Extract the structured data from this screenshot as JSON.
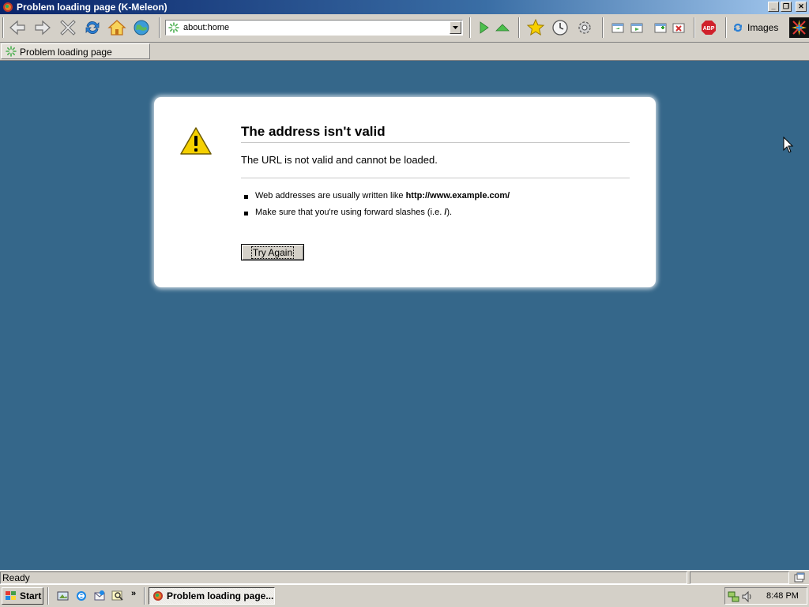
{
  "window": {
    "title": "Problem loading page (K-Meleon)",
    "controls": [
      "minimize",
      "restore",
      "close"
    ]
  },
  "toolbar": {
    "buttons": [
      "back-icon",
      "forward-icon",
      "stop-icon",
      "reload-icon",
      "home-icon",
      "globe-icon",
      "go-icon",
      "up-icon",
      "bookmarks-star-icon",
      "history-clock-icon",
      "settings-gear-icon",
      "window-prev-icon",
      "window-next-icon",
      "new-window-icon",
      "close-window-icon",
      "adblock-icon"
    ],
    "url": "about:home",
    "images_label": "Images"
  },
  "tabs": [
    {
      "label": "Problem loading page"
    }
  ],
  "error": {
    "title": "The address isn't valid",
    "message": "The URL is not valid and cannot be loaded.",
    "bullet1_prefix": "Web addresses are usually written like ",
    "bullet1_bold": "http://www.example.com/",
    "bullet2_prefix": "Make sure that you're using forward slashes (i.e. ",
    "bullet2_bold": "/",
    "bullet2_suffix": ").",
    "try_again": "Try Again"
  },
  "status": {
    "text": "Ready"
  },
  "taskbar": {
    "start": "Start",
    "task_label": "Problem loading page...",
    "more": "»",
    "clock": "8:48 PM"
  },
  "colors": {
    "page_background": "#35678a",
    "title_gradient_start": "#0a246a",
    "chrome": "#d4d0c8"
  }
}
